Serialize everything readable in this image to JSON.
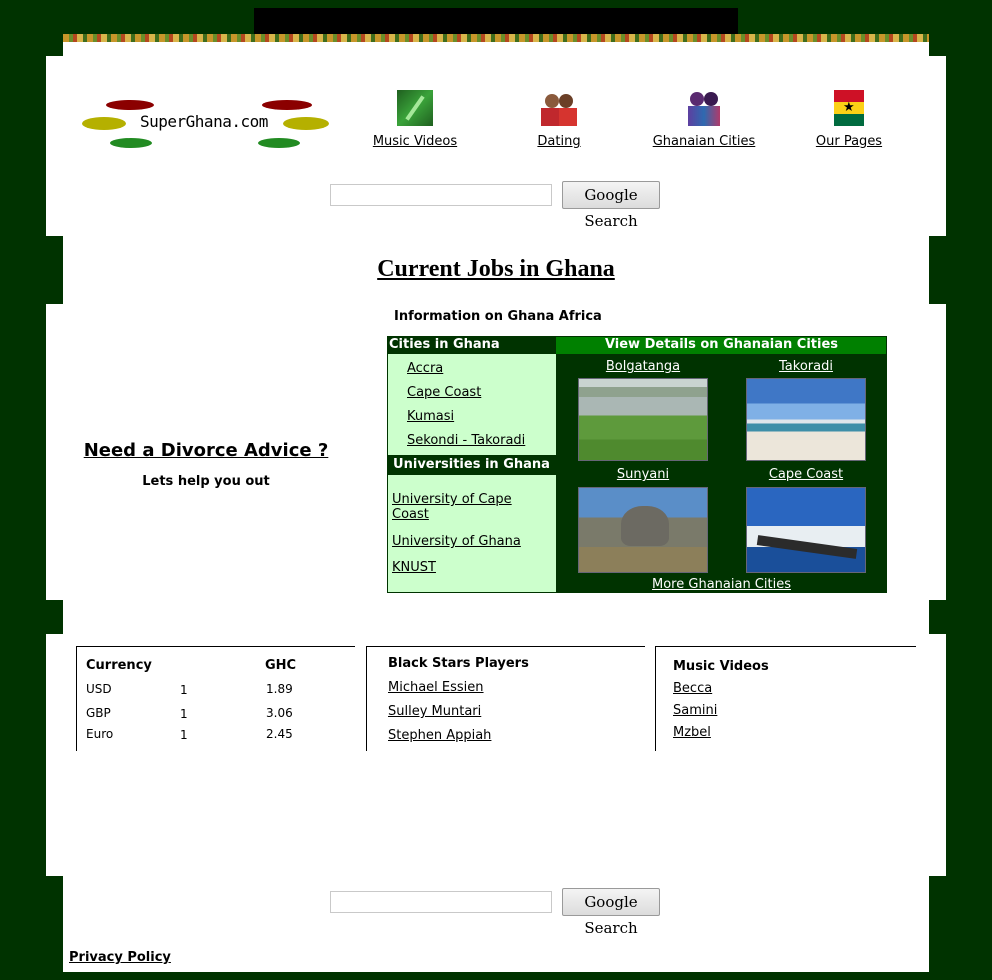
{
  "logo": {
    "text": "SuperGhana.com"
  },
  "nav": [
    {
      "label": "Music Videos",
      "icon": "guitar-icon"
    },
    {
      "label": "Dating",
      "icon": "couple-icon"
    },
    {
      "label": "Ghanaian Cities",
      "icon": "people-icon"
    },
    {
      "label": "Our Pages",
      "icon": "ghana-map-flag-icon"
    }
  ],
  "search": {
    "button_label": "Google Search",
    "value": "",
    "placeholder": ""
  },
  "page": {
    "title": "Current Jobs in Ghana",
    "info_heading": "Information on Ghana Africa"
  },
  "divorce": {
    "title": "Need a Divorce Advice ?",
    "subtitle": "Lets help you out"
  },
  "cities_panel": {
    "cities_header": "Cities in Ghana",
    "cities": [
      "Accra",
      "Cape Coast",
      "Kumasi",
      "Sekondi - Takoradi"
    ],
    "universities_header": "Universities in Ghana",
    "universities": [
      "University of Cape Coast",
      "University of Ghana",
      "KNUST"
    ],
    "details_header": "View Details on Ghanaian Cities",
    "photos": [
      "Bolgatanga",
      "Takoradi",
      "Sunyani",
      "Cape Coast"
    ],
    "more_link": "More Ghanaian Cities"
  },
  "currency": {
    "headers": [
      "Currency",
      "",
      "GHC"
    ],
    "rows": [
      [
        "USD",
        "1",
        "1.89"
      ],
      [
        "GBP",
        "1",
        "3.06"
      ],
      [
        "Euro",
        "1",
        "2.45"
      ]
    ]
  },
  "players": {
    "title": "Black Stars Players",
    "items": [
      "Michael Essien",
      "Sulley Muntari",
      "Stephen Appiah"
    ]
  },
  "music": {
    "title": "Music Videos",
    "items": [
      "Becca",
      "Samini",
      "Mzbel"
    ]
  },
  "footer": {
    "privacy": "Privacy Policy"
  },
  "colors": {
    "background": "#003300",
    "accent_green": "#008000",
    "light_green": "#ccffcc"
  }
}
